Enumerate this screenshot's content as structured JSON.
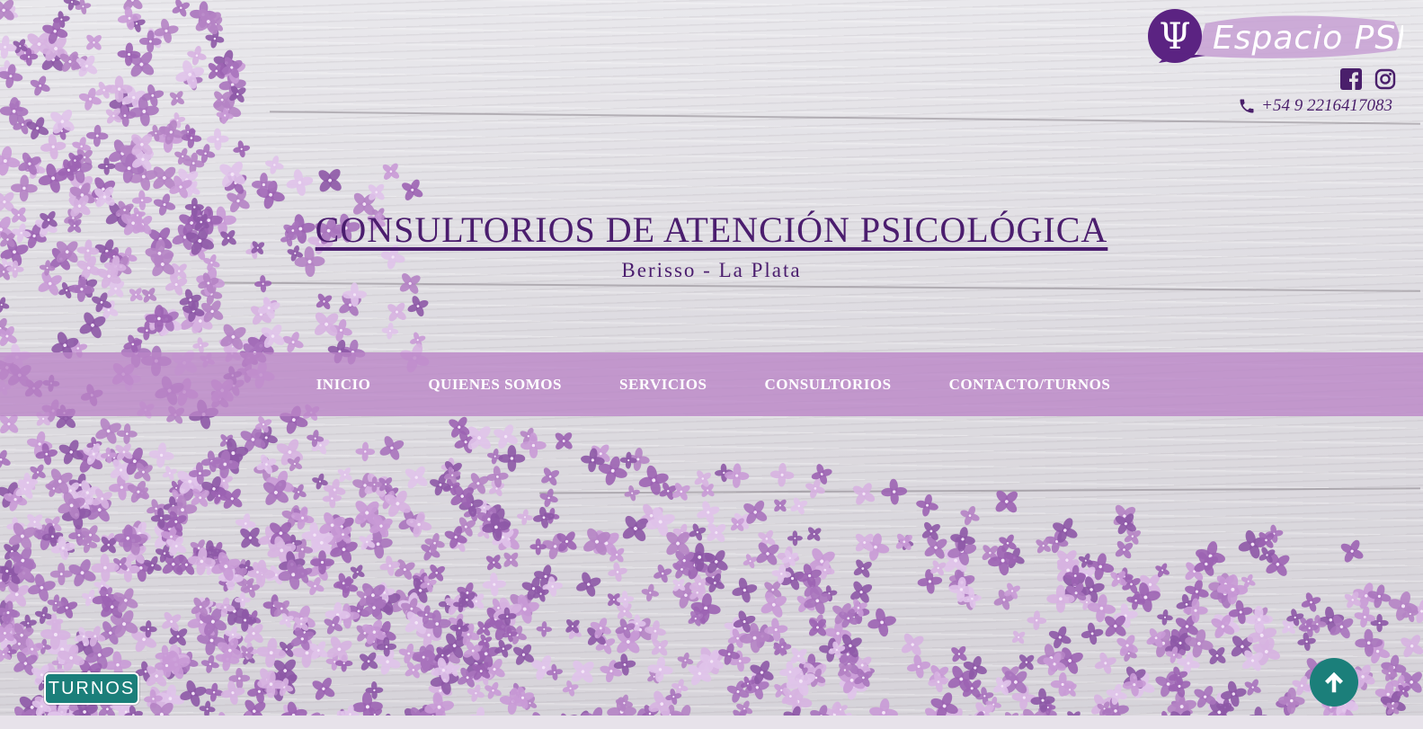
{
  "brand": {
    "logo_symbol": "Ψ",
    "logo_text": "Espacio PSI",
    "social_icons": [
      "facebook-square-icon",
      "instagram-icon"
    ],
    "phone_icon": "phone-icon",
    "phone": "+54 9 2216417083"
  },
  "hero": {
    "title": "CONSULTORIOS DE ATENCIÓN PSICOLÓGICA",
    "subtitle": "Berisso - La Plata"
  },
  "nav": {
    "items": [
      {
        "label": "INICIO"
      },
      {
        "label": "QUIENES SOMOS"
      },
      {
        "label": "SERVICIOS"
      },
      {
        "label": "CONSULTORIOS"
      },
      {
        "label": "CONTACTO/TURNOS"
      }
    ]
  },
  "floating": {
    "turnos_label": "TURNOS",
    "scroll_top_icon": "arrow-up-icon"
  },
  "colors": {
    "brand_purple": "#4b1d6e",
    "nav_band": "#ba84c6",
    "accent_teal": "#1b7f7a"
  }
}
